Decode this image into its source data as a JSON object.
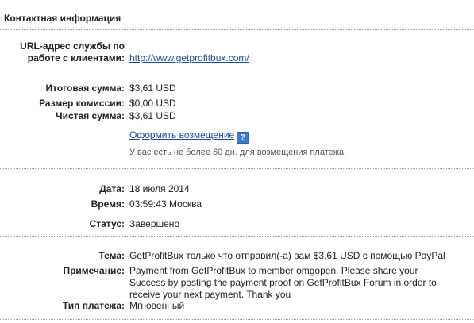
{
  "header": {
    "title": "Контактная информация"
  },
  "contact": {
    "url_label_line1": "URL-адрес службы по",
    "url_label_line2": "работе с клиентами:",
    "url": "http://www.getprofitbux.com/"
  },
  "amounts": {
    "total_label": "Итоговая сумма:",
    "total_value": "$3,61 USD",
    "fee_label": "Размер комиссии:",
    "fee_value": "$0,00 USD",
    "net_label": "Чистая сумма:",
    "net_value": "$3,61 USD",
    "refund_link": "Оформить возмещение",
    "help_icon": "question-mark-icon",
    "refund_note": "У вас есть не более 60 дн. для возмещения платежа."
  },
  "datetime": {
    "date_label": "Дата:",
    "date_value": "18 июля 2014",
    "time_label": "Время:",
    "time_value": "03:59:43 Москва",
    "status_label": "Статус:",
    "status_value": "Завершено"
  },
  "details": {
    "subject_label": "Тема:",
    "subject_value": "GetProfitBux только что отправил(-а) вам $3,61 USD с помощью PayPal",
    "note_label": "Примечание:",
    "note_line1": "Payment from GetProfitBux to member omgopen. Please share your",
    "note_line2": "Success by posting the payment proof on GetProfitBux Forum in order to",
    "note_line3": "receive your next payment. Thank you",
    "type_label": "Тип платежа:",
    "type_value": "Мгновенный"
  },
  "colors": {
    "link": "#1a4c9e",
    "divider": "#9a9a9a",
    "help_icon_bg": "#3a7bd5"
  }
}
